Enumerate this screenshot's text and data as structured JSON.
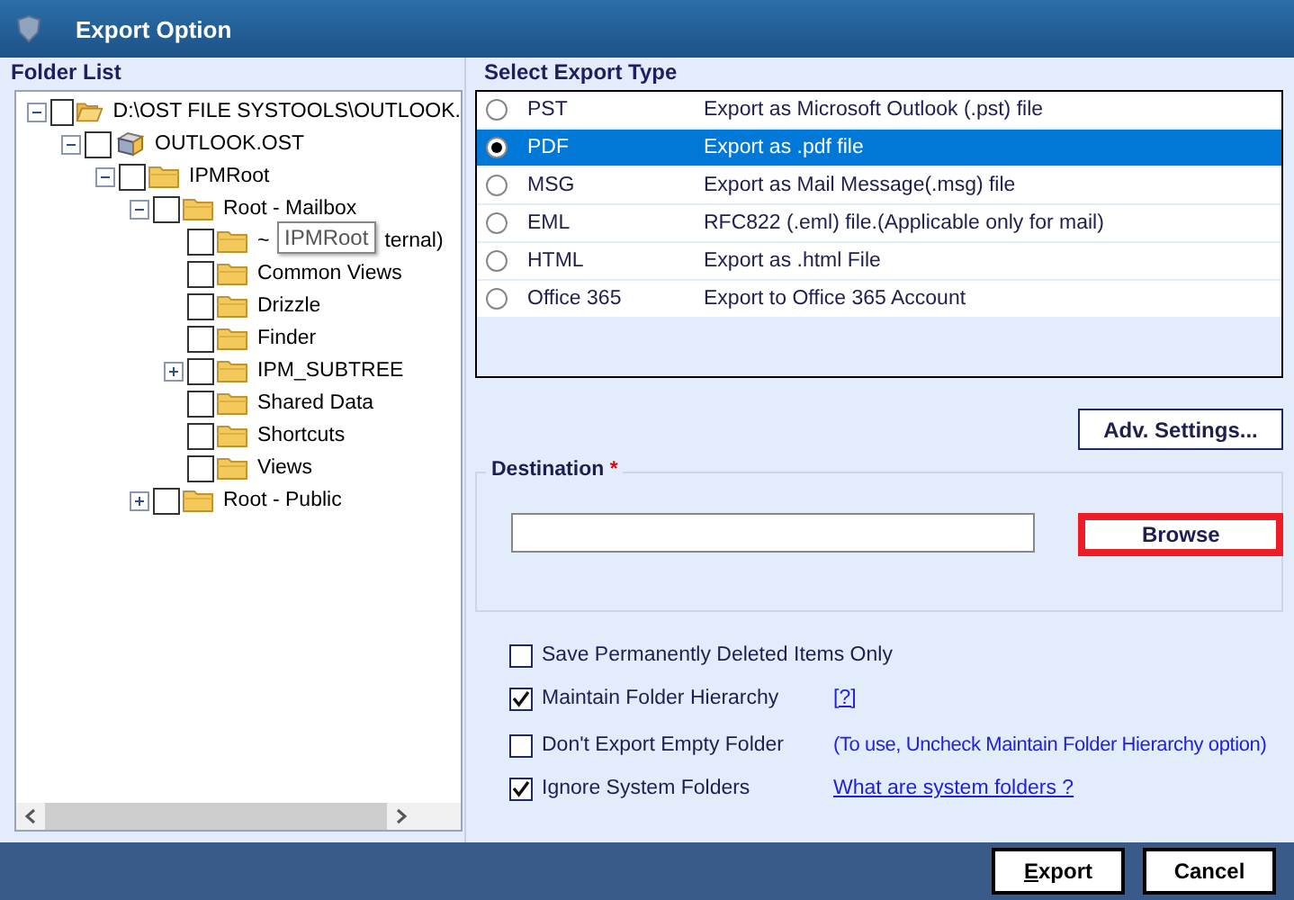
{
  "window": {
    "title": "Export Option"
  },
  "folder_list": {
    "title": "Folder List",
    "tree": [
      {
        "label": "D:\\OST FILE SYSTOOLS\\OUTLOOK.",
        "kind": "open-folder",
        "expanded": true,
        "checked": false,
        "children": [
          {
            "label": "OUTLOOK.OST",
            "kind": "file",
            "expanded": true,
            "checked": false,
            "children": [
              {
                "label": "IPMRoot",
                "kind": "folder",
                "expanded": true,
                "checked": false,
                "children": [
                  {
                    "label": "Root - Mailbox",
                    "kind": "folder",
                    "expanded": true,
                    "checked": false,
                    "children": [
                      {
                        "label": "~",
                        "label_tail": "ternal)",
                        "kind": "folder",
                        "checked": false,
                        "tooltip": "IPMRoot"
                      },
                      {
                        "label": "Common Views",
                        "kind": "folder",
                        "checked": false
                      },
                      {
                        "label": "Drizzle",
                        "kind": "folder",
                        "checked": false
                      },
                      {
                        "label": "Finder",
                        "kind": "folder",
                        "checked": false
                      },
                      {
                        "label": "IPM_SUBTREE",
                        "kind": "folder",
                        "expanded": false,
                        "checked": false
                      },
                      {
                        "label": "Shared Data",
                        "kind": "folder",
                        "checked": false
                      },
                      {
                        "label": "Shortcuts",
                        "kind": "folder",
                        "checked": false
                      },
                      {
                        "label": "Views",
                        "kind": "folder",
                        "checked": false
                      }
                    ]
                  },
                  {
                    "label": "Root - Public",
                    "kind": "folder",
                    "expanded": false,
                    "checked": false
                  }
                ]
              }
            ]
          }
        ]
      }
    ]
  },
  "export_type": {
    "title": "Select Export Type",
    "options": [
      {
        "name": "PST",
        "description": "Export as Microsoft Outlook (.pst) file",
        "selected": false
      },
      {
        "name": "PDF",
        "description": "Export as .pdf file",
        "selected": true
      },
      {
        "name": "MSG",
        "description": "Export as Mail Message(.msg) file",
        "selected": false
      },
      {
        "name": "EML",
        "description": "RFC822 (.eml) file.(Applicable only for mail)",
        "selected": false
      },
      {
        "name": "HTML",
        "description": "Export as .html File",
        "selected": false
      },
      {
        "name": "Office 365",
        "description": "Export to Office 365 Account",
        "selected": false
      }
    ]
  },
  "adv_settings_button": "Adv. Settings...",
  "destination": {
    "title": "Destination",
    "required_mark": "*",
    "browse_button": "Browse",
    "browse_highlighted": true
  },
  "options": [
    {
      "label": "Save Permanently Deleted Items Only",
      "checked": false
    },
    {
      "label": "Maintain Folder Hierarchy",
      "checked": true,
      "extra": {
        "kind": "link",
        "text": "[?]"
      }
    },
    {
      "label": "Don't Export Empty Folder",
      "checked": false,
      "extra": {
        "kind": "note",
        "text": "(To use, Uncheck Maintain Folder Hierarchy option)"
      }
    },
    {
      "label": "Ignore System Folders",
      "checked": true,
      "extra": {
        "kind": "link",
        "text": "What are system folders ?"
      }
    }
  ],
  "buttons": [
    {
      "label": "Export",
      "mnemonic": true
    },
    {
      "label": "Cancel",
      "mnemonic": false
    }
  ]
}
